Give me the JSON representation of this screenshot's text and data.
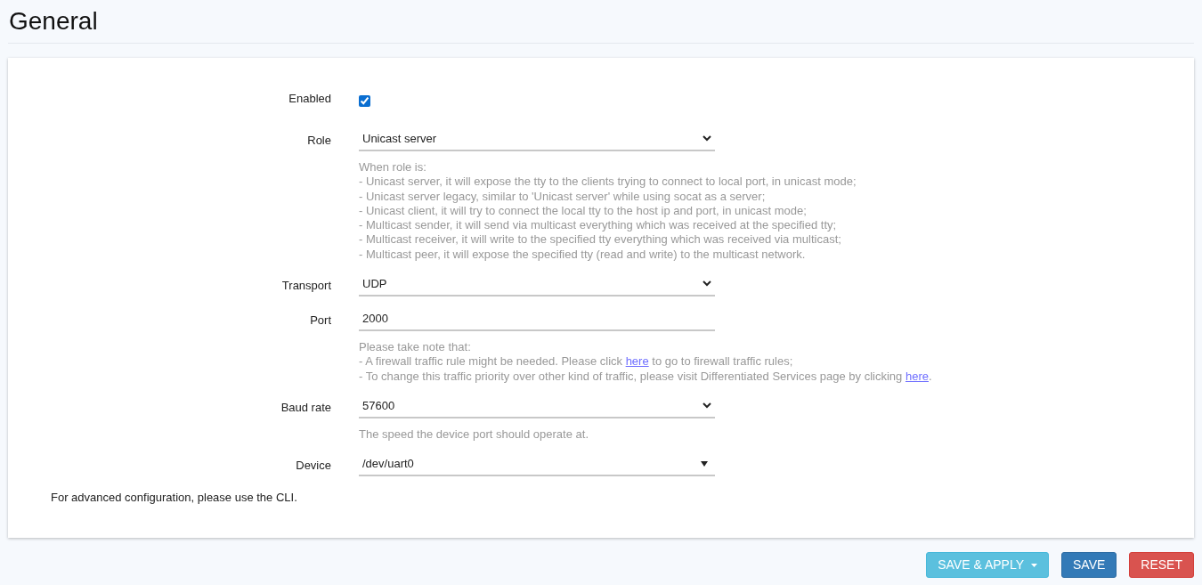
{
  "title": "General",
  "fields": [
    {
      "kind": "checkbox",
      "label": "Enabled",
      "checked": true
    },
    {
      "kind": "select",
      "label": "Role",
      "value": "Unicast server",
      "help": [
        [
          {
            "kind": "text",
            "text": "When role is:"
          }
        ],
        [
          {
            "kind": "text",
            "text": "- Unicast server, it will expose the tty to the clients trying to connect to local port, in unicast mode;"
          }
        ],
        [
          {
            "kind": "text",
            "text": "- Unicast server legacy, similar to 'Unicast server' while using socat as a server;"
          }
        ],
        [
          {
            "kind": "text",
            "text": "- Unicast client, it will try to connect the local tty to the host ip and port, in unicast mode;"
          }
        ],
        [
          {
            "kind": "text",
            "text": "- Multicast sender, it will send via multicast everything which was received at the specified tty;"
          }
        ],
        [
          {
            "kind": "text",
            "text": "- Multicast receiver, it will write to the specified tty everything which was received via multicast;"
          }
        ],
        [
          {
            "kind": "text",
            "text": "- Multicast peer, it will expose the specified tty (read and write) to the multicast network."
          }
        ]
      ]
    },
    {
      "kind": "select",
      "label": "Transport",
      "value": "UDP"
    },
    {
      "kind": "input",
      "label": "Port",
      "value": "2000",
      "help": [
        [
          {
            "kind": "text",
            "text": "Please take note that:"
          }
        ],
        [
          {
            "kind": "text",
            "text": "- A firewall traffic rule might be needed. Please click "
          },
          {
            "kind": "link",
            "text": "here"
          },
          {
            "kind": "text",
            "text": " to go to firewall traffic rules;"
          }
        ],
        [
          {
            "kind": "text",
            "text": "- To change this traffic priority over other kind of traffic, please visit Differentiated Services page by clicking "
          },
          {
            "kind": "link",
            "text": "here"
          },
          {
            "kind": "text",
            "text": "."
          }
        ]
      ]
    },
    {
      "kind": "select",
      "label": "Baud rate",
      "value": "57600",
      "help": [
        [
          {
            "kind": "text",
            "text": "The speed the device port should operate at."
          }
        ]
      ]
    },
    {
      "kind": "combo",
      "label": "Device",
      "value": "/dev/uart0"
    }
  ],
  "note": "For advanced configuration, please use the CLI.",
  "buttons": [
    {
      "kind": "apply",
      "label": "SAVE & APPLY"
    },
    {
      "kind": "save",
      "label": "SAVE"
    },
    {
      "kind": "reset",
      "label": "RESET"
    }
  ]
}
